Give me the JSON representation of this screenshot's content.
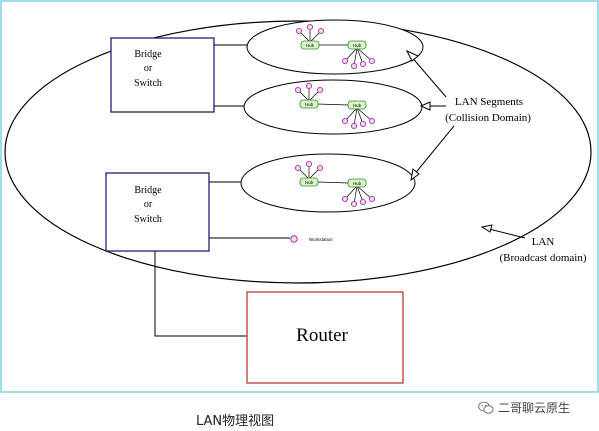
{
  "diagram": {
    "bridge_top": {
      "line1": "Bridge",
      "line2": "or",
      "line3": "Switch"
    },
    "bridge_bottom": {
      "line1": "Bridge",
      "line2": "or",
      "line3": "Switch"
    },
    "hub_label": "Hub",
    "workstation_label": "Workstation",
    "lan_segments": {
      "line1": "LAN Segments",
      "line2": "(Collision Domain)"
    },
    "lan": {
      "line1": "LAN",
      "line2": "(Broadcast domain)"
    },
    "router_label": "Router",
    "colors": {
      "frame_border": "#7fd3e6",
      "bridge_border": "#1e1e78",
      "router_border": "#c0392b",
      "hub_fill": "#d8f5c8",
      "hub_stroke": "#2e8b2e",
      "node_stroke": "#b030b0",
      "node_fill": "#f4d8f4",
      "line": "#000000"
    }
  },
  "caption": "LAN物理视图",
  "watermark": {
    "text": "二哥聊云原生",
    "icon": "wechat-icon"
  }
}
